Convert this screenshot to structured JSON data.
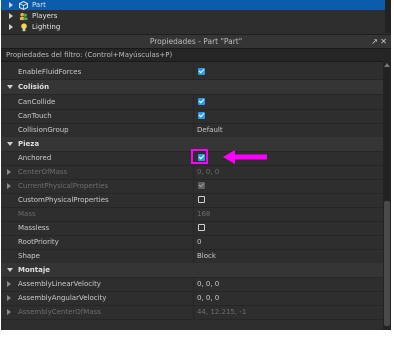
{
  "explorer": {
    "items": [
      {
        "label": "Part",
        "icon": "part-cube-icon",
        "selected": true
      },
      {
        "label": "Players",
        "icon": "players-icon",
        "selected": false
      },
      {
        "label": "Lighting",
        "icon": "lightbulb-icon",
        "selected": false
      }
    ]
  },
  "properties_panel": {
    "title": "Propiedades - Part \"Part\"",
    "filter_placeholder": "Propiedades del filtro: (Control+Mayúsculas+P)",
    "rows": {
      "enable_fluid_forces": {
        "name": "EnableFluidForces",
        "checked": true
      },
      "cat_collision": "Colisión",
      "can_collide": {
        "name": "CanCollide",
        "checked": true
      },
      "can_touch": {
        "name": "CanTouch",
        "checked": true
      },
      "collision_group": {
        "name": "CollisionGroup",
        "value": "Default"
      },
      "cat_part": "Pieza",
      "anchored": {
        "name": "Anchored",
        "checked": true
      },
      "center_of_mass": {
        "name": "CenterOfMass",
        "value": "0, 0, 0"
      },
      "current_physical_properties": {
        "name": "CurrentPhysicalProperties",
        "checked": true
      },
      "custom_physical_properties": {
        "name": "CustomPhysicalProperties",
        "checked": false
      },
      "mass": {
        "name": "Mass",
        "value": "168"
      },
      "massless": {
        "name": "Massless",
        "checked": false
      },
      "root_priority": {
        "name": "RootPriority",
        "value": "0"
      },
      "shape": {
        "name": "Shape",
        "value": "Block"
      },
      "cat_assembly": "Montaje",
      "assembly_linear_velocity": {
        "name": "AssemblyLinearVelocity",
        "value": "0, 0, 0"
      },
      "assembly_angular_velocity": {
        "name": "AssemblyAngularVelocity",
        "value": "0, 0, 0"
      },
      "assembly_center_of_mass": {
        "name": "AssemblyCenterOfMass",
        "value": "44, 12.215, -1"
      }
    }
  },
  "colors": {
    "panel_bg": "#2e2e2e",
    "selection": "#0b5cad",
    "checkbox_on": "#2b9ae8",
    "annotation": "#ff00ff"
  }
}
